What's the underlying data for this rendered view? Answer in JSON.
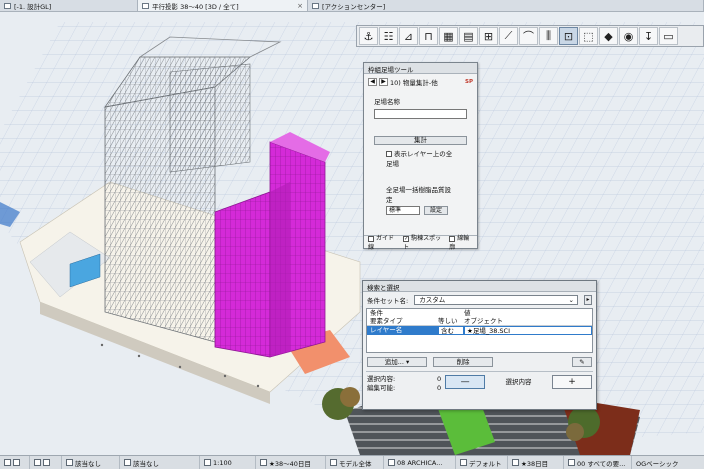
{
  "tabs": [
    {
      "label": "[-1. 設計GL]"
    },
    {
      "label": "平行投影 38〜40 [3D / 全て]"
    },
    {
      "label": "[アクションセンター]"
    }
  ],
  "toolbar_icons": [
    "hook-icon",
    "ladder-icon",
    "stair-icon",
    "shelf-icon",
    "grid-icon",
    "panel-icon",
    "book-icon",
    "ruler-icon",
    "roof-icon",
    "level-icon",
    "frame-icon",
    "board-icon",
    "cube-icon",
    "eye-icon",
    "arrow-down-icon"
  ],
  "palette": {
    "title": "枠組足場ツール",
    "nav_label": "10) 物量集計-他",
    "badge": "SP",
    "name_label": "足場名称",
    "name_value": "",
    "sum_button": "集計",
    "layer_check": "表示レイヤー上の全足場",
    "bulk_label": "全足場一括樹脂品質設定",
    "select_value": "標準",
    "settings_button": "設定",
    "bottom": {
      "guide": "ガイド線",
      "snap": "駒棟スポット",
      "outline": "線輪廓"
    }
  },
  "dialog": {
    "title": "検索と選択",
    "set_label": "条件セット名:",
    "set_value": "カスタム",
    "col_condition": "条件",
    "col_value": "値",
    "col_element_type": "要素タイプ",
    "col_equals": "等しい",
    "col_object": "オブジェクト",
    "row_layer": "レイヤー名",
    "row_op": "含む",
    "row_value": "★足場_38.SCI",
    "add_button": "追加...",
    "delete_button": "削除",
    "selected_label": "選択内容:",
    "selected_value": "0",
    "editable_label": "編集可能:",
    "editable_value": "0",
    "minus_button": "—",
    "selection_label": "選択内容",
    "plus_button": "+"
  },
  "statusbar": [
    "該当なし",
    "該当なし",
    "1:100",
    "★38〜40日目",
    "モデル全体",
    "08 ARCHICA...",
    "デフォルト",
    "★38日目",
    "00 すべての要...",
    "OGベーシック"
  ],
  "colors": {
    "scaffold_magenta": "#d42ad8",
    "building_gray": "#a9acaf",
    "selection_blue": "#2f7bcb"
  }
}
